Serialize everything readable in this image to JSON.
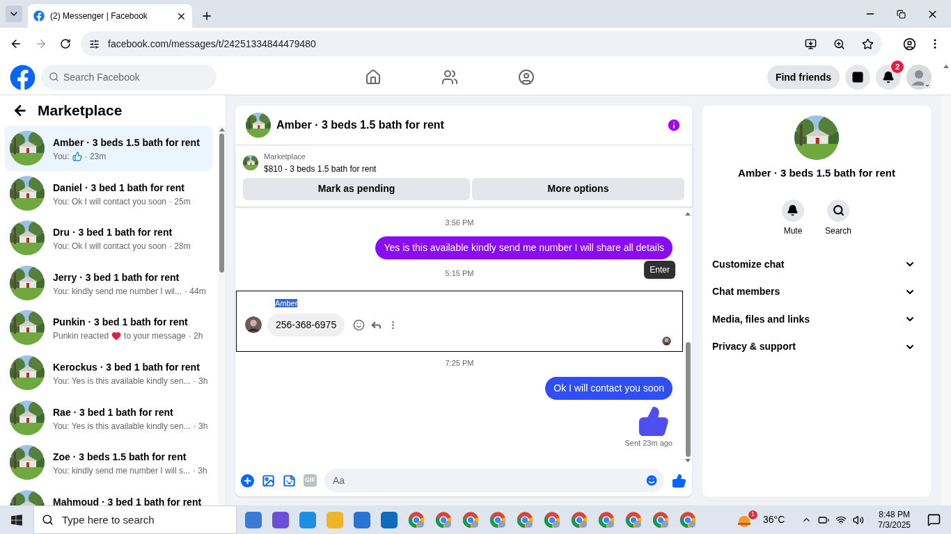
{
  "browser": {
    "tab_title": "(2) Messenger | Facebook",
    "url": "facebook.com/messages/t/24251334844479480"
  },
  "header": {
    "search_placeholder": "Search Facebook",
    "find_friends": "Find friends",
    "notification_count": "2"
  },
  "sidebar": {
    "title": "Marketplace",
    "conversations": [
      {
        "name": "Amber · 3 beds 1.5 bath for rent",
        "preview": "You:",
        "kind": "like",
        "time": "· 23m",
        "selected": true
      },
      {
        "name": "Daniel · 3 bed 1 bath for rent",
        "preview": "You: Ok I will contact you soon",
        "time": "· 25m",
        "selected": false
      },
      {
        "name": "Dru · 3 bed 1 bath for rent",
        "preview": "You: Ok I will contact you soon",
        "time": "· 28m",
        "selected": false
      },
      {
        "name": "Jerry · 3 bed 1 bath for rent",
        "preview": "You: kindly send me number I wil...",
        "time": "· 44m",
        "selected": false
      },
      {
        "name": "Punkin · 3 bed 1 bath for rent",
        "preview": "Punkin reacted",
        "kind": "heart",
        "preview_after": "to your message",
        "time": "· 2h",
        "selected": false
      },
      {
        "name": "Kerockus · 3 bed 1 bath for rent",
        "preview": "You: Yes is this available kindly sen...",
        "time": "· 3h",
        "selected": false
      },
      {
        "name": "Rae · 3 bed 1 bath for rent",
        "preview": "You: Yes is this available kindly sen...",
        "time": "· 3h",
        "selected": false
      },
      {
        "name": "Zoe · 3 beds 1.5 bath for rent",
        "preview": "You: kindly send me number I will s...",
        "time": "· 3h",
        "selected": false
      },
      {
        "name": "Mahmoud · 3 bed 1 bath for rent",
        "selected": false
      }
    ]
  },
  "chat": {
    "title": "Amber · 3 beds 1.5 bath for rent",
    "listing": {
      "label": "Marketplace",
      "title": "$810 - 3 beds 1.5 bath for rent"
    },
    "buttons": [
      "Mark as pending",
      "More options"
    ],
    "messages": [
      {
        "kind": "time",
        "text": "3:56 PM"
      },
      {
        "kind": "sent",
        "text": "Yes is this available kindly send me number I will share all details",
        "color": "#8a0cf5"
      },
      {
        "kind": "time",
        "text": "5:15 PM",
        "tooltip": "Enter"
      },
      {
        "kind": "received",
        "sender": "Amber",
        "sender_selected": true,
        "focused": true,
        "text": "256-368-6975"
      },
      {
        "kind": "time",
        "text": "7:25 PM"
      },
      {
        "kind": "sent",
        "text": "Ok I will contact you soon",
        "color": "#2f4ff5"
      },
      {
        "kind": "like",
        "color": "#4f4ff0"
      }
    ],
    "status": "Sent 23m ago",
    "composer": {
      "gif_label": "GIF",
      "placeholder": "Aa"
    }
  },
  "details": {
    "title": "Amber · 3 beds 1.5 bath for rent",
    "actions": [
      {
        "kind": "mute",
        "label": "Mute"
      },
      {
        "kind": "search",
        "label": "Search"
      }
    ],
    "sections": [
      {
        "label": "Customize chat",
        "expanded": false
      },
      {
        "label": "Chat members",
        "expanded": false
      },
      {
        "label": "Media, files and links",
        "expanded": false
      },
      {
        "label": "Privacy & support",
        "expanded": false
      }
    ]
  },
  "taskbar": {
    "search_placeholder": "Type here to search",
    "weather_badge": "1",
    "temperature": "36°C",
    "time": "8:48 PM",
    "date": "7/3/2025"
  }
}
